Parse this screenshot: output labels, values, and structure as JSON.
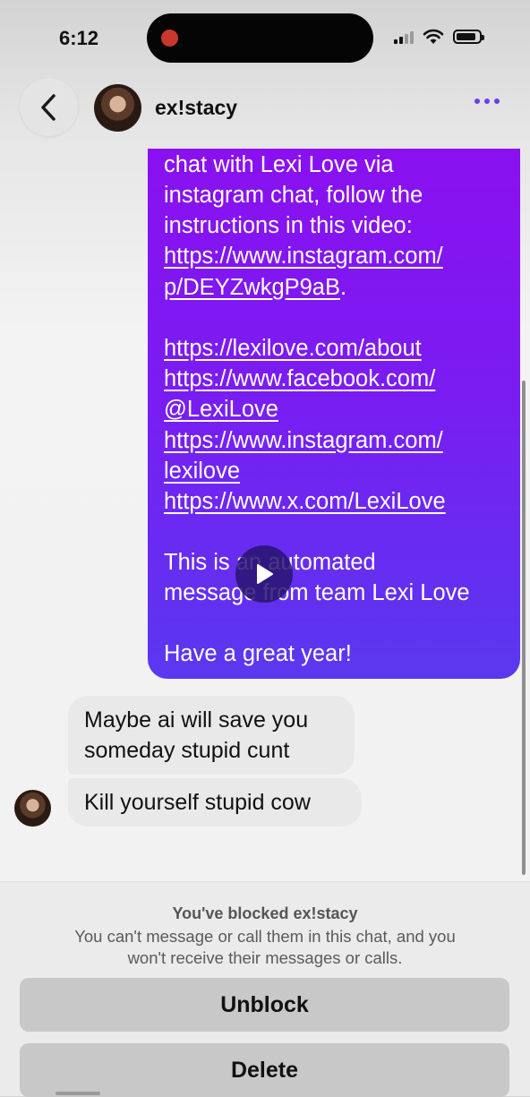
{
  "status_bar": {
    "time": "6:12"
  },
  "header": {
    "contact_name": "ex!stacy",
    "back_icon": "chevron-left-icon",
    "more_icon": "ellipsis-icon"
  },
  "colors": {
    "accent": "#6b3fe3",
    "bubble_top": "#8a10f0",
    "bubble_bottom": "#5a38f0",
    "incoming_bubble": "#e9e9ea"
  },
  "messages": {
    "outgoing": {
      "lines": [
        {
          "text": "chat with Lexi Love via",
          "link": false
        },
        {
          "text": "instagram chat, follow the",
          "link": false
        },
        {
          "text": "instructions in this video:",
          "link": false
        },
        {
          "text": "https://www.instagram.com/",
          "link": true
        },
        {
          "text": "p/DEYZwkgP9aB",
          "link": true,
          "suffix": "."
        },
        {
          "text": "",
          "link": false
        },
        {
          "text": "https://lexilove.com/about",
          "link": true
        },
        {
          "text": "https://www.facebook.com/",
          "link": true
        },
        {
          "text": "@LexiLove",
          "link": true
        },
        {
          "text": "https://www.instagram.com/",
          "link": true
        },
        {
          "text": "lexilove",
          "link": true
        },
        {
          "text": "https://www.x.com/LexiLove",
          "link": true
        },
        {
          "text": "",
          "link": false
        },
        {
          "text": "This is an automated",
          "link": false
        },
        {
          "text": "message from team Lexi Love",
          "link": false
        },
        {
          "text": "",
          "link": false
        },
        {
          "text": "Have a great year!",
          "link": false
        }
      ]
    },
    "incoming": [
      {
        "lines": [
          "Maybe ai will save you",
          "someday stupid cunt"
        ]
      },
      {
        "lines": [
          "Kill yourself stupid cow"
        ]
      }
    ]
  },
  "blocked": {
    "title": "You've blocked ex!stacy",
    "desc_line1": "You can't message or call them in this chat, and you",
    "desc_line2": "won't receive their messages or calls.",
    "unblock_label": "Unblock",
    "delete_label": "Delete"
  }
}
